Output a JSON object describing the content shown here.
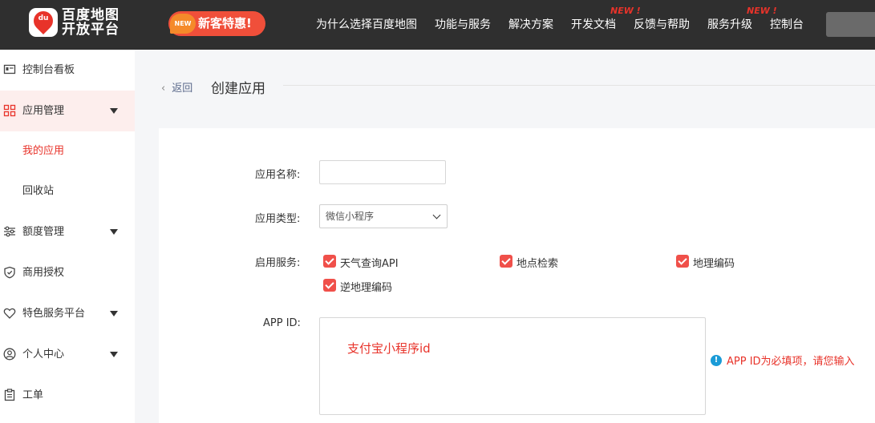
{
  "brand": {
    "logo_line1": "百度地图",
    "logo_line2": "开放平台",
    "pin_text": "du"
  },
  "promo": {
    "badge": "NEW",
    "text": "新客特惠!"
  },
  "nav": {
    "items": [
      "为什么选择百度地图",
      "功能与服务",
      "解决方案",
      "开发文档",
      "反馈与帮助",
      "服务升级",
      "控制台"
    ],
    "new_tag": "NEW !"
  },
  "sidebar": {
    "items": [
      {
        "label": "控制台看板",
        "icon": "dashboard-icon"
      },
      {
        "label": "应用管理",
        "icon": "apps-grid-icon"
      },
      {
        "label": "我的应用"
      },
      {
        "label": "回收站"
      },
      {
        "label": "额度管理",
        "icon": "sliders-icon"
      },
      {
        "label": "商用授权",
        "icon": "shield-check-icon"
      },
      {
        "label": "特色服务平台",
        "icon": "heart-icon"
      },
      {
        "label": "个人中心",
        "icon": "user-icon"
      },
      {
        "label": "工单",
        "icon": "clipboard-icon"
      }
    ]
  },
  "header": {
    "back": "返回",
    "title": "创建应用"
  },
  "form": {
    "name_label": "应用名称:",
    "name_value": "",
    "type_label": "应用类型:",
    "type_value": "微信小程序",
    "services_label": "启用服务:",
    "services": [
      {
        "label": "天气查询API",
        "checked": true
      },
      {
        "label": "地点检索",
        "checked": true
      },
      {
        "label": "地理编码",
        "checked": true
      },
      {
        "label": "逆地理编码",
        "checked": true
      }
    ],
    "appid_label": "APP ID:",
    "appid_value": "支付宝小程序id",
    "appid_hint": "APP ID为必填项，请您输入",
    "hint_icon": "!"
  },
  "colors": {
    "accent": "#e8332a",
    "topbar": "#2f2f2f",
    "checkbox": "#f0504a",
    "hint_icon": "#1a9bd7"
  }
}
